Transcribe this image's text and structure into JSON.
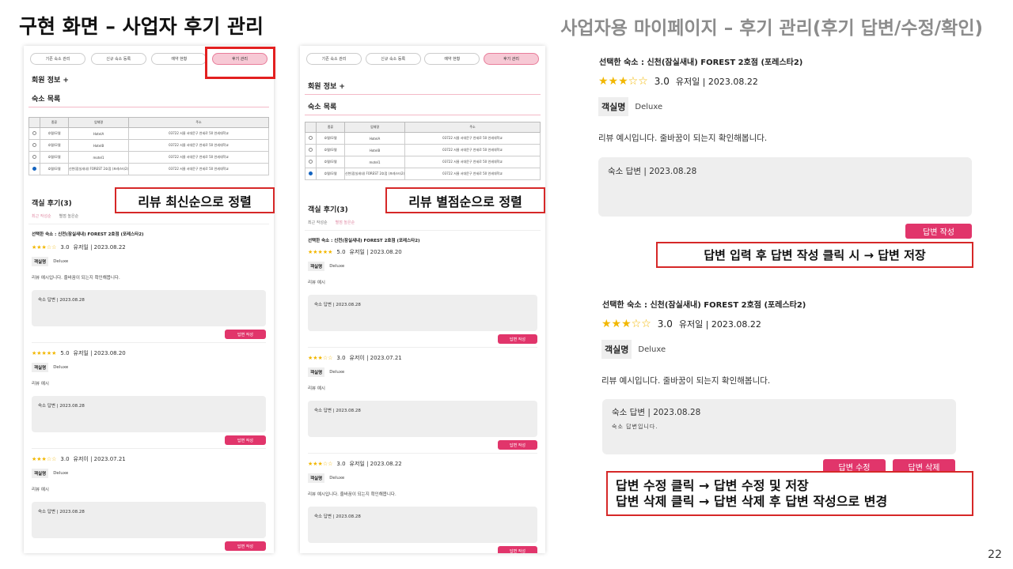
{
  "slide": {
    "title": "구현 화면 – 사업자 후기 관리",
    "subtitle": "사업자용 마이페이지 – 후기 관리(후기 답변/수정/확인)",
    "page_number": "22"
  },
  "nav_tabs": [
    "기존 숙소 관리",
    "신규 숙소 등록",
    "예약 현황",
    "후기 관리"
  ],
  "member_info_label": "회원 정보 +",
  "accommodation_list": {
    "title": "숙소 목록",
    "columns": [
      "종류",
      "업체명",
      "주소"
    ],
    "rows": [
      {
        "type": "호텔/모텔",
        "name": "HotelA",
        "address": "03722 서울 서대문구 연세로 50 연세대학교"
      },
      {
        "type": "호텔/모텔",
        "name": "HotelB",
        "address": "03722 서울 서대문구 연세로 50 연세대학교"
      },
      {
        "type": "호텔/모텔",
        "name": "motel1",
        "address": "03722 서울 서대문구 연세로 50 연세대학교"
      },
      {
        "type": "호텔/모텔",
        "name": "신천(잠실새내) FOREST 2호점 (포레스타2)",
        "address": "03722 서울 서대문구 연세로 50 연세대학교"
      }
    ]
  },
  "reviews_section": {
    "title": "객실 후기(3)",
    "sort_latest": "최근 작성순",
    "sort_rating": "별점 높은순",
    "selected_label": "선택한 숙소 : 신천(잠실새내) FOREST 2호점 (포레스타2)",
    "room_label": "객실명",
    "answer_header": "숙소 답변 | 2023.08.28",
    "write_button": "답변 작성",
    "edit_button": "답변 수정",
    "delete_button": "답변 삭제",
    "answer_text": "숙소 답변입니다."
  },
  "reviews_latest": [
    {
      "stars": "★★★☆☆",
      "score": "3.0",
      "meta": "유저일 | 2023.08.22",
      "room": "Deluxe",
      "text": "리뷰 예시입니다. 줄바꿈이 되는지 확인해봅니다."
    },
    {
      "stars": "★★★★★",
      "score": "5.0",
      "meta": "유저일 | 2023.08.20",
      "room": "Deluxe",
      "text": "리뷰 예시"
    },
    {
      "stars": "★★★☆☆",
      "score": "3.0",
      "meta": "유저이 | 2023.07.21",
      "room": "Deluxe",
      "text": "리뷰 예시"
    }
  ],
  "reviews_rating": [
    {
      "stars": "★★★★★",
      "score": "5.0",
      "meta": "유저일 | 2023.08.20",
      "room": "Deluxe",
      "text": "리뷰 예시"
    },
    {
      "stars": "★★★☆☆",
      "score": "3.0",
      "meta": "유저이 | 2023.07.21",
      "room": "Deluxe",
      "text": "리뷰 예시"
    },
    {
      "stars": "★★★☆☆",
      "score": "3.0",
      "meta": "유저일 | 2023.08.22",
      "room": "Deluxe",
      "text": "리뷰 예시입니다. 줄바꿈이 되는지 확인해봅니다."
    }
  ],
  "detail_review": {
    "stars": "★★★☆☆",
    "score": "3.0",
    "meta": "유저일 | 2023.08.22",
    "room": "Deluxe",
    "text": "리뷰 예시입니다. 줄바꿈이 되는지 확인해봅니다."
  },
  "callouts": {
    "latest_sort": "리뷰 최신순으로 정렬",
    "rating_sort": "리뷰 별점순으로 정렬",
    "save_answer": "답변 입력 후 답변 작성 클릭 시 → 답변 저장",
    "edit_line1": "답변 수정 클릭 → 답변 수정 및 저장",
    "edit_line2": "답변 삭제 클릭 → 답변 삭제 후 답변 작성으로 변경"
  },
  "colors": {
    "accent": "#e1356b",
    "callout_border": "#d62828",
    "tab_active": "#f7c9d5",
    "stars": "#f2b700"
  }
}
